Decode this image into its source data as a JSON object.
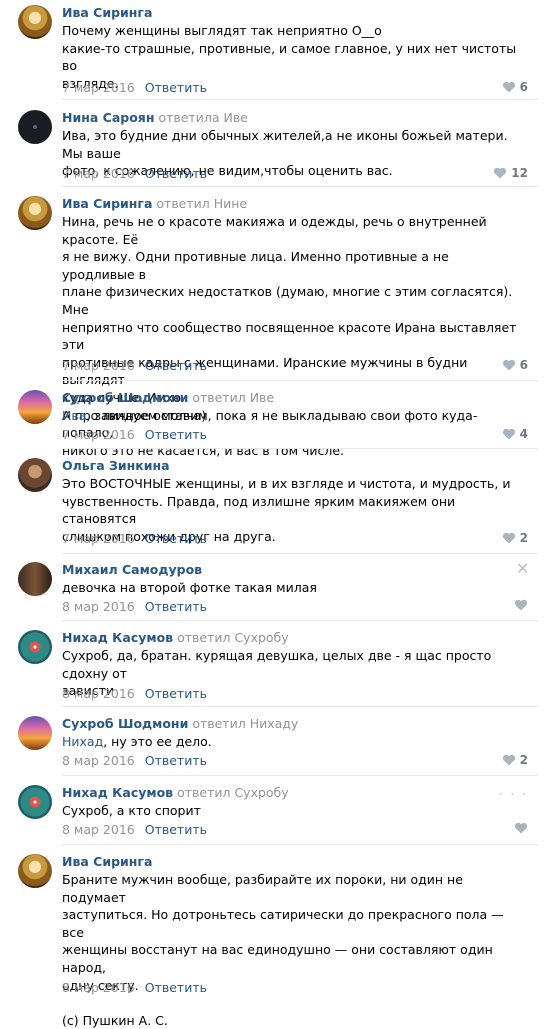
{
  "reply_label": "Ответить",
  "comments": [
    {
      "author": "Ива Сиринга",
      "reply_word": "",
      "reply_to": "",
      "text": "Почему женщины выглядят так неприятно О__о\nкакие-то страшные, противные, и самое главное, у них нет чистоты во\nвзгляде.",
      "mention": "",
      "date": "7 мар 2016",
      "likes": "6",
      "avatar": "gold"
    },
    {
      "author": "Нина Сароян",
      "reply_word": "ответила",
      "reply_to": "Иве",
      "text": "Ива, это будние дни обычных жителей,а не иконы божьей матери. Мы ваше\nфото, к сожалению, не видим,чтобы оценить вас.",
      "mention": "",
      "date": "7 мар 2016",
      "likes": "12",
      "avatar": "dark"
    },
    {
      "author": "Ива Сиринга",
      "reply_word": "ответил",
      "reply_to": "Нине",
      "text": "Нина, речь не о красоте макияжа и одежды, речь о внутренней красоте. Её\nя не вижу. Одни противные лица. Именно противные а не уродливые в\nплане физических недостатков (думаю, многие с этим согласятся). Мне\nнеприятно что сообщество посвященное красоте Ирана выставляет эти\nпротивные кадры с женщинами. Иранские мужчины в будни выглядят\nкуда лучше. Имхо.\nА про личное оставим, пока я не выкладываю свои фото куда-попало,\nникого это не касается, и вас в том числе.",
      "mention": "",
      "date": "7 мар 2016",
      "likes": "6",
      "avatar": "gold"
    },
    {
      "author": "Сухроб Шодмони",
      "reply_word": "ответил",
      "reply_to": "Иве",
      "text": ", завидуем молча)",
      "mention": "Ива",
      "date": "7 мар 2016",
      "likes": "4",
      "avatar": "sunset"
    },
    {
      "author": "Ольга Зинкина",
      "reply_word": "",
      "reply_to": "",
      "text": "Это ВОСТОЧНЫЕ женщины, и в их взгляде и чистота, и мудрость, и\nчувственность. Правда, под излишне ярким макияжем они становятся\nслишком похожи друг на друга.",
      "mention": "",
      "date": "7 мар 2016",
      "likes": "2",
      "avatar": "olga"
    },
    {
      "author": "Михаил Самодуров",
      "reply_word": "",
      "reply_to": "",
      "text": "девочка на второй фотке такая милая",
      "mention": "",
      "date": "8 мар 2016",
      "likes": "",
      "avatar": "mikhail"
    },
    {
      "author": "Нихад Касумов",
      "reply_word": "ответил",
      "reply_to": "Сухробу",
      "text": "Сухроб, да, братан. курящая девушка, целых две - я щас просто сдохну от\nзависти",
      "mention": "",
      "date": "8 мар 2016",
      "likes": "",
      "avatar": "nihad"
    },
    {
      "author": "Сухроб Шодмони",
      "reply_word": "ответил",
      "reply_to": "Нихаду",
      "text": ", ну это ее дело.",
      "mention": "Нихад",
      "date": "8 мар 2016",
      "likes": "2",
      "avatar": "sunset"
    },
    {
      "author": "Нихад Касумов",
      "reply_word": "ответил",
      "reply_to": "Сухробу",
      "text": "Сухроб, а кто спорит",
      "mention": "",
      "date": "8 мар 2016",
      "likes": "",
      "avatar": "nihad"
    },
    {
      "author": "Ива Сиринга",
      "reply_word": "",
      "reply_to": "",
      "text": "Браните мужчин вообще, разбирайте их пороки, ни один не подумает\nзаступиться. Но дотроньтесь сатирически до прекрасного пола — все\nженщины восстанут на вас единодушно — они составляют один народ,\nодну секту.\n\n(c) Пушкин А. С.",
      "mention": "",
      "date": "8 мар 2016",
      "likes": "",
      "avatar": "gold"
    }
  ]
}
